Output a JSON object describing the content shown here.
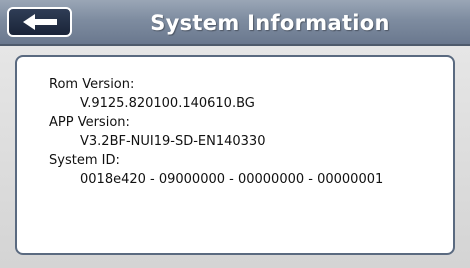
{
  "header": {
    "title": "System Information",
    "back_icon": "back-arrow-icon"
  },
  "info": {
    "rom_version_label": "Rom Version:",
    "rom_version_value": "V.9125.820100.140610.BG",
    "app_version_label": "APP Version:",
    "app_version_value": "V3.2BF-NUI19-SD-EN140330",
    "system_id_label": "System ID:",
    "system_id_value": "0018e420 - 09000000 - 00000000 - 00000001"
  },
  "colors": {
    "header_gradient_top": "#9aa6b6",
    "header_gradient_bottom": "#6a788e",
    "back_button_fill": "#1a2438",
    "panel_border": "#5a6a80",
    "background": "#dcdcdc"
  }
}
